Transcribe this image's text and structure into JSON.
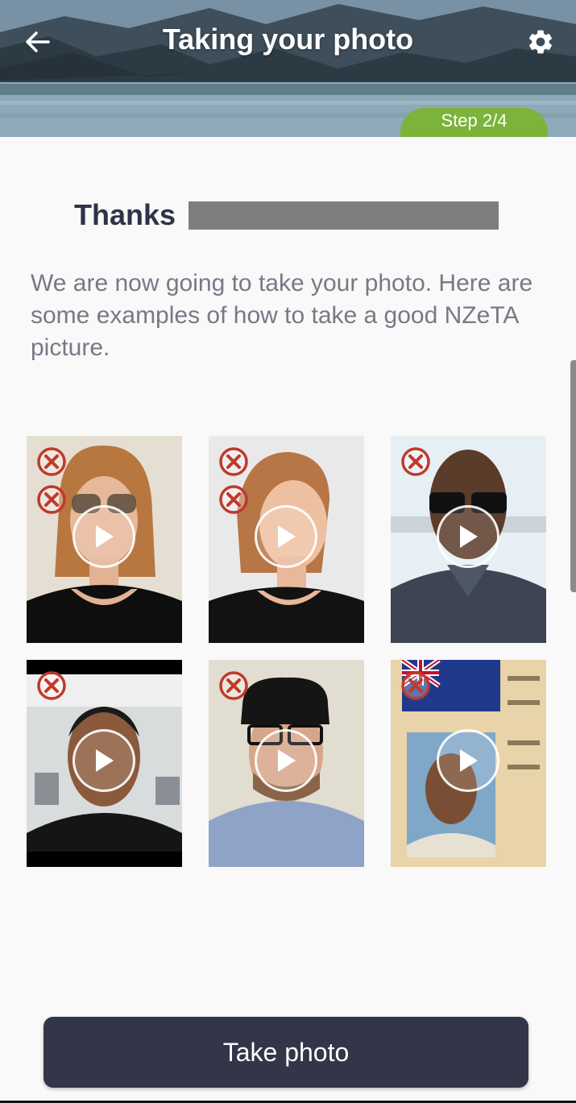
{
  "header": {
    "title": "Taking your photo",
    "back_icon": "arrow-left-icon",
    "settings_icon": "gear-icon",
    "step_label": "Step 2/4"
  },
  "greeting": {
    "thanks_word": "Thanks"
  },
  "intro_text": "We are now going to take your photo. Here are some examples of how to take a good NZeTA picture.",
  "examples": [
    {
      "id": "sunglasses-example",
      "bad_marks": 2
    },
    {
      "id": "side-profile-example",
      "bad_marks": 2
    },
    {
      "id": "dark-background-example",
      "bad_marks": 1
    },
    {
      "id": "office-background-example",
      "bad_marks": 1
    },
    {
      "id": "hat-example",
      "bad_marks": 1
    },
    {
      "id": "id-card-photo-example",
      "bad_marks": 1
    }
  ],
  "colors": {
    "accent_green": "#7cb33a",
    "button_dark": "#333648",
    "error_red": "#c0392b"
  },
  "actions": {
    "take_photo_label": "Take photo"
  }
}
